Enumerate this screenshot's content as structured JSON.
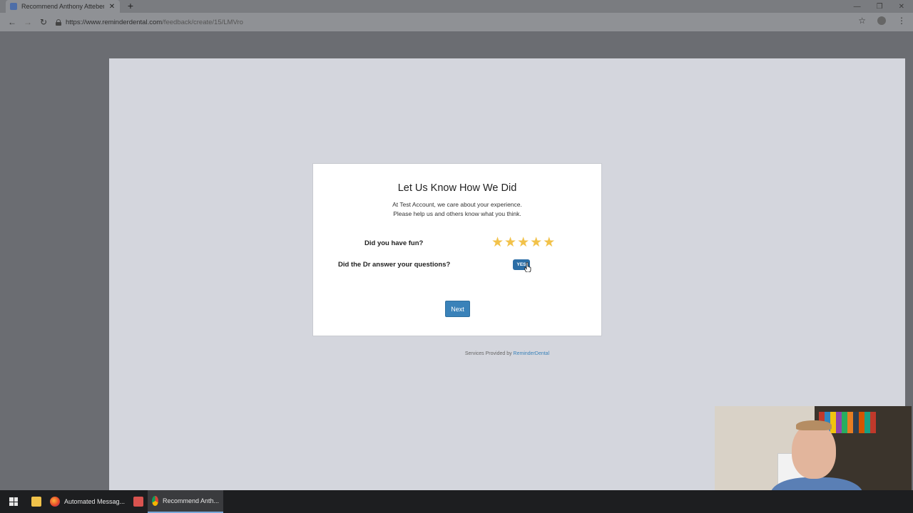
{
  "browser": {
    "tab_title": "Recommend Anthony Attebery D",
    "tab_close": "✕",
    "new_tab": "+",
    "url_prefix": "https://www.reminderdental.com",
    "url_path": "/feedback/create/15/LMVro",
    "window_controls": [
      "—",
      "❐",
      "✕"
    ]
  },
  "form": {
    "title": "Let Us Know How We Did",
    "intro_line1": "At Test Account, we care about your experience.",
    "intro_line2": "Please help us and others know what you think.",
    "question1": "Did you have fun?",
    "rating": 5,
    "rating_max": 5,
    "question2": "Did the Dr answer your questions?",
    "toggle_label": "YES",
    "next_label": "Next"
  },
  "footer": {
    "prefix": "Services Provided by ",
    "link": "ReminderDental"
  },
  "taskbar": {
    "firefox_label": "Automated Messag...",
    "chrome_label": "Recommend Anth..."
  },
  "colors": {
    "star": "#f2c24a",
    "primary_button": "#3a82b9",
    "toggle": "#2c6ea6",
    "page_bg": "#d4d6dd"
  }
}
